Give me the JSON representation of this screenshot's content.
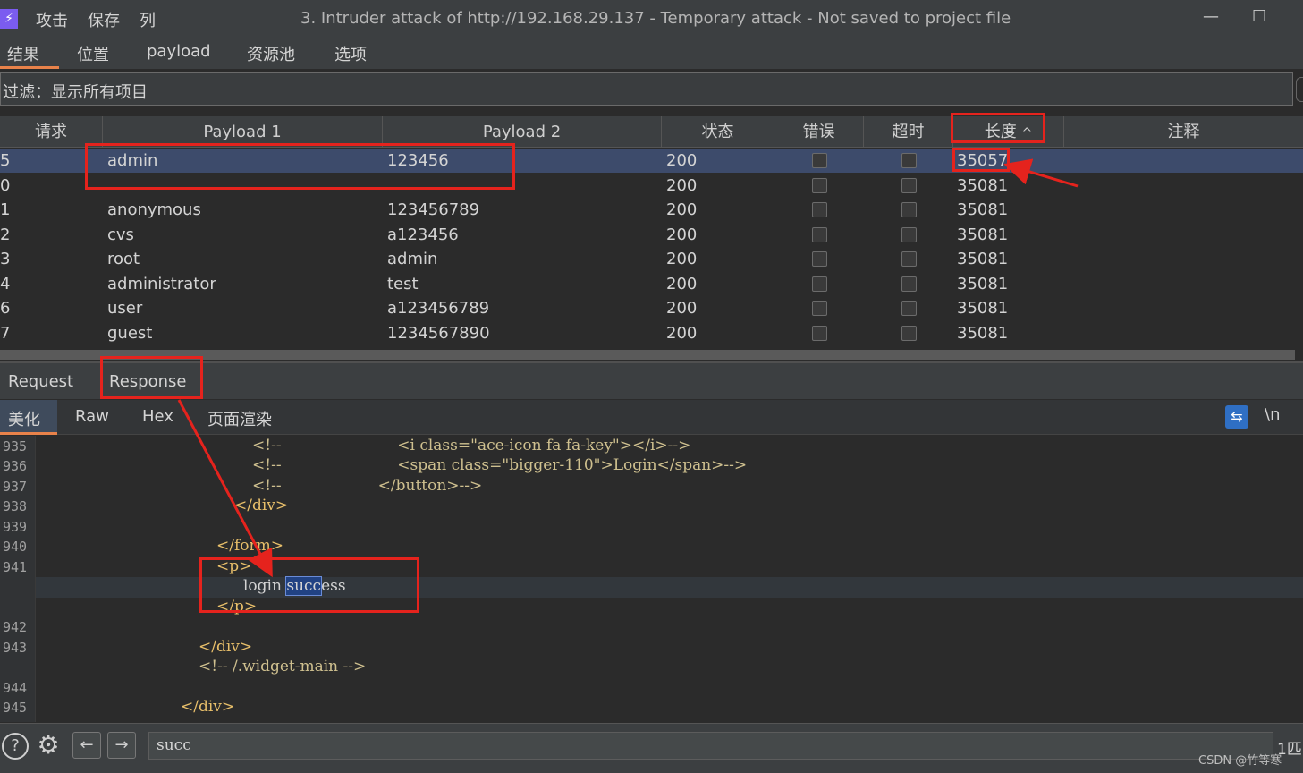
{
  "titlebar": {
    "app_icon": "⚡",
    "menu": [
      "攻击",
      "保存",
      "列"
    ],
    "title": "3. Intruder attack of http://192.168.29.137 - Temporary attack - Not saved to project file",
    "minimize": "—",
    "maximize": "☐"
  },
  "main_tabs": [
    "结果",
    "位置",
    "payload",
    "资源池",
    "选项"
  ],
  "filter": {
    "text": "过滤：显示所有项目"
  },
  "table": {
    "columns": [
      "请求",
      "Payload 1",
      "Payload 2",
      "状态",
      "错误",
      "超时",
      "长度",
      "注释"
    ],
    "sort_indicator": "^",
    "rows": [
      {
        "req": "5",
        "p1": "admin",
        "p2": "123456",
        "status": "200",
        "length": "35057"
      },
      {
        "req": "0",
        "p1": "",
        "p2": "",
        "status": "200",
        "length": "35081"
      },
      {
        "req": "1",
        "p1": "anonymous",
        "p2": "123456789",
        "status": "200",
        "length": "35081"
      },
      {
        "req": "2",
        "p1": "cvs",
        "p2": "a123456",
        "status": "200",
        "length": "35081"
      },
      {
        "req": "3",
        "p1": "root",
        "p2": "admin",
        "status": "200",
        "length": "35081"
      },
      {
        "req": "4",
        "p1": "administrator",
        "p2": "test",
        "status": "200",
        "length": "35081"
      },
      {
        "req": "6",
        "p1": "user",
        "p2": "a123456789",
        "status": "200",
        "length": "35081"
      },
      {
        "req": "7",
        "p1": "guest",
        "p2": "1234567890",
        "status": "200",
        "length": "35081"
      }
    ]
  },
  "rr_tabs": [
    "Request",
    "Response"
  ],
  "sub_tabs": [
    "美化",
    "Raw",
    "Hex",
    "页面渲染"
  ],
  "editor_icons": {
    "wrap": "⇆",
    "newline": "\\n"
  },
  "code_lines": [
    {
      "ln": "935",
      "text": "<!--                        <i class=\"ace-icon fa fa-key\"></i>-->"
    },
    {
      "ln": "936",
      "text": "<!--                        <span class=\"bigger-110\">Login</span>-->"
    },
    {
      "ln": "937",
      "text": "<!--                    </button>-->"
    },
    {
      "ln": "938",
      "text": "</div>"
    },
    {
      "ln": "939",
      "text": ""
    },
    {
      "ln": "940",
      "text": "</form>"
    },
    {
      "ln": "941",
      "text": "<p>"
    },
    {
      "ln": "",
      "text": "login success"
    },
    {
      "ln": "",
      "text": "</p>"
    },
    {
      "ln": "942",
      "text": ""
    },
    {
      "ln": "943",
      "text": "</div>"
    },
    {
      "ln": "",
      "text": "<!-- /.widget-main -->"
    },
    {
      "ln": "944",
      "text": ""
    },
    {
      "ln": "945",
      "text": "</div>"
    }
  ],
  "code_highlight": {
    "match": "succ",
    "rest": "ess",
    "prefix": "login "
  },
  "search": {
    "value": "succ",
    "match_count": "1匹"
  },
  "watermark": "CSDN @竹等寒"
}
